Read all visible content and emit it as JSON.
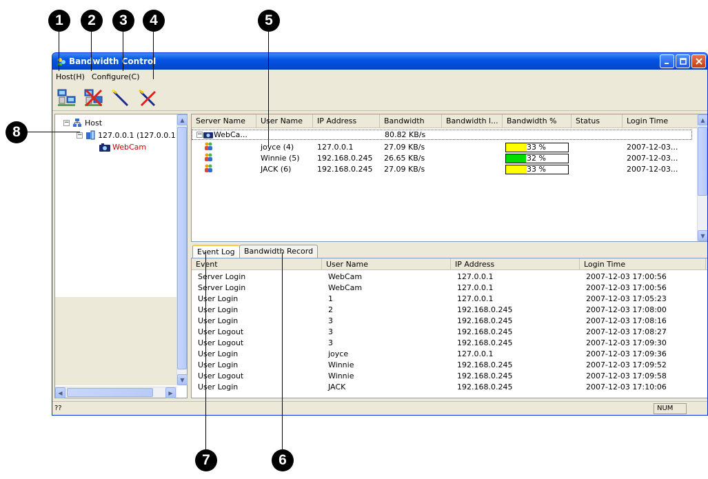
{
  "callouts": {
    "c1": "1",
    "c2": "2",
    "c3": "3",
    "c4": "4",
    "c5": "5",
    "c6": "6",
    "c7": "7",
    "c8": "8"
  },
  "window": {
    "title": "Bandwidth Control"
  },
  "menu": {
    "host": "Host(H)",
    "configure": "Configure(C)"
  },
  "toolbar": {
    "icons": [
      "add-server-icon",
      "remove-server-icon",
      "wand-icon",
      "wand-cross-icon"
    ]
  },
  "tree": {
    "root": "Host",
    "server": "127.0.0.1 (127.0.0.1",
    "camera": "WebCam",
    "camera_color": "#cc0000"
  },
  "server_list": {
    "columns": [
      "Server Name",
      "User Name",
      "IP Address",
      "Bandwidth",
      "Bandwidth l...",
      "Bandwidth %",
      "Status",
      "Login Time"
    ],
    "group": {
      "server": "WebCa...",
      "bandwidth": "80.82 KB/s"
    },
    "rows": [
      {
        "user": "joyce (4)",
        "ip": "127.0.0.1",
        "bandwidth": "27.09 KB/s",
        "percent_label": "33 %",
        "percent": 33,
        "fill": "#ffff00",
        "login": "2007-12-03..."
      },
      {
        "user": "Winnie (5)",
        "ip": "192.168.0.245",
        "bandwidth": "26.65 KB/s",
        "percent_label": "32 %",
        "percent": 32,
        "fill": "#00dd00",
        "login": "2007-12-03..."
      },
      {
        "user": "JACK (6)",
        "ip": "192.168.0.245",
        "bandwidth": "27.09 KB/s",
        "percent_label": "33 %",
        "percent": 33,
        "fill": "#ffff00",
        "login": "2007-12-03..."
      }
    ]
  },
  "tabs": {
    "event_log": "Event Log",
    "bandwidth_record": "Bandwidth Record"
  },
  "event_log": {
    "columns": [
      "Event",
      "User Name",
      "IP Address",
      "Login Time"
    ],
    "rows": [
      [
        "Server Login",
        "WebCam",
        "127.0.0.1",
        "2007-12-03 17:00:56"
      ],
      [
        "Server Login",
        "WebCam",
        "127.0.0.1",
        "2007-12-03 17:00:56"
      ],
      [
        "User Login",
        "1",
        "127.0.0.1",
        "2007-12-03 17:05:23"
      ],
      [
        "User Login",
        "2",
        "192.168.0.245",
        "2007-12-03 17:08:00"
      ],
      [
        "User Login",
        "3",
        "192.168.0.245",
        "2007-12-03 17:08:16"
      ],
      [
        "User Logout",
        "3",
        "192.168.0.245",
        "2007-12-03 17:08:27"
      ],
      [
        "User Logout",
        "3",
        "192.168.0.245",
        "2007-12-03 17:09:30"
      ],
      [
        "User Login",
        "joyce",
        "127.0.0.1",
        "2007-12-03 17:09:36"
      ],
      [
        "User Login",
        "Winnie",
        "192.168.0.245",
        "2007-12-03 17:09:52"
      ],
      [
        "User Logout",
        "Winnie",
        "192.168.0.245",
        "2007-12-03 17:09:58"
      ],
      [
        "User Login",
        "JACK",
        "192.168.0.245",
        "2007-12-03 17:10:06"
      ]
    ]
  },
  "status": {
    "left": "??",
    "num": "NUM"
  }
}
